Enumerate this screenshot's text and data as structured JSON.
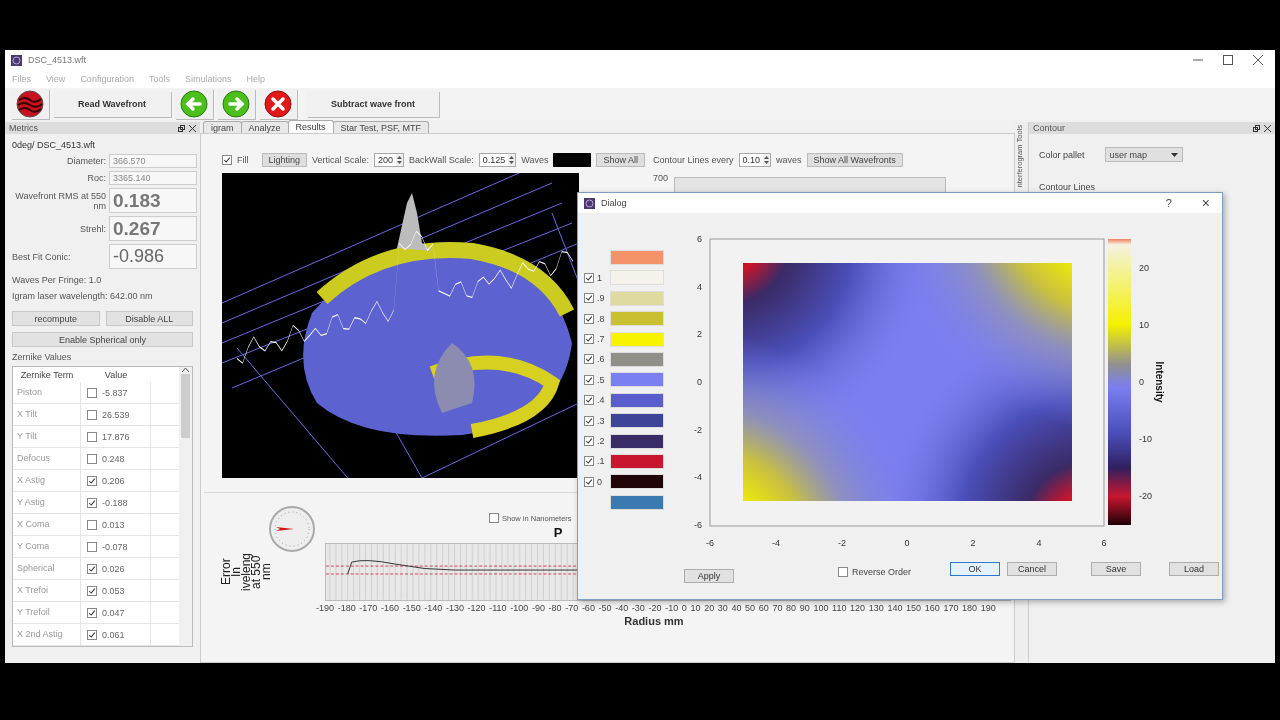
{
  "window": {
    "title": "DSC_4513.wft"
  },
  "menu": [
    "Files",
    "View",
    "Configuration",
    "Tools",
    "Simulations",
    "Help"
  ],
  "toolbar": [
    {
      "kind": "igram"
    },
    {
      "kind": "text",
      "label": "Read Wavefront"
    },
    {
      "kind": "back"
    },
    {
      "kind": "forward"
    },
    {
      "kind": "cancel"
    },
    {
      "kind": "text",
      "label": "Subtract wave front"
    }
  ],
  "metrics": {
    "title": "Metrics",
    "file": "0deg/ DSC_4513.wft",
    "fields": [
      {
        "kind": "small",
        "label": "Diameter:",
        "value": "366.570"
      },
      {
        "kind": "small",
        "label": "Roc:",
        "value": "3365.140"
      },
      {
        "kind": "big",
        "label": "Wavefront RMS at 550 nm",
        "value": "0.183"
      },
      {
        "kind": "big",
        "label": "Strehl:",
        "value": "0.267"
      },
      {
        "kind": "light",
        "label": "Best Fit Conic:",
        "value": "-0.986"
      }
    ],
    "notes": [
      "Waves Per Fringe: 1.0",
      "Igram laser wavelength: 642.00 nm"
    ],
    "buttons": [
      "recompute",
      "Disable ALL",
      "Enable Spherical only"
    ],
    "zernike": {
      "title": "Zernike Values",
      "columns": [
        "Zernike Term",
        "Value"
      ],
      "rows": [
        {
          "term": "Piston",
          "checked": false,
          "value": "-5.837"
        },
        {
          "term": "X Tilt",
          "checked": false,
          "value": "26.539"
        },
        {
          "term": "Y Tilt",
          "checked": false,
          "value": "17.876"
        },
        {
          "term": "Defocus",
          "checked": false,
          "value": "0.248"
        },
        {
          "term": "X Astig",
          "checked": true,
          "value": "0.206"
        },
        {
          "term": "Y Astig",
          "checked": true,
          "value": "-0.188"
        },
        {
          "term": "X Coma",
          "checked": false,
          "value": "0.013"
        },
        {
          "term": "Y Coma",
          "checked": false,
          "value": "-0.078"
        },
        {
          "term": "Spherical",
          "checked": true,
          "value": "0.026"
        },
        {
          "term": "X Trefoi",
          "checked": true,
          "value": "0.053"
        },
        {
          "term": "Y Trefoil",
          "checked": true,
          "value": "0.047"
        },
        {
          "term": "X 2nd Astig",
          "checked": true,
          "value": "0.061"
        }
      ]
    }
  },
  "tabs": [
    {
      "label": "igram",
      "selected": false
    },
    {
      "label": "Analyze",
      "selected": false
    },
    {
      "label": "Results",
      "selected": true
    },
    {
      "label": "Star Test, PSF, MTF",
      "selected": false
    }
  ],
  "surface_controls": {
    "fill": {
      "label": "Fill",
      "checked": true
    },
    "lighting": "Lighting",
    "vertical_scale": {
      "label": "Vertical Scale:",
      "value": "200"
    },
    "backwall_scale": {
      "label": "BackWall Scale:",
      "value": "0.125"
    },
    "waves_label": "Waves",
    "show_all": "Show All"
  },
  "contour_controls": {
    "label": "Contour Lines every",
    "value": "0.10",
    "unit": "waves",
    "button": "Show All Wavefronts",
    "tick": "700"
  },
  "profile": {
    "nanometers": {
      "label": "Show in Nanometers",
      "checked": false
    },
    "title": "P",
    "ylabel_lines": [
      "Error",
      "In",
      "iveleng",
      "at 550",
      "nm"
    ],
    "xticks": [
      "-190",
      "-180",
      "-170",
      "-160",
      "-150",
      "-140",
      "-130",
      "-120",
      "-110",
      "-100",
      "-90",
      "-80",
      "-70",
      "-60",
      "-50",
      "-40",
      "-30",
      "-20",
      "-10",
      "0",
      "10",
      "20",
      "30",
      "40",
      "50",
      "60",
      "70",
      "80",
      "90",
      "100",
      "110",
      "120",
      "130",
      "140",
      "150",
      "160",
      "170",
      "180",
      "190"
    ],
    "xlabel": "Radius mm"
  },
  "contour_dock": {
    "side_tab": "nterferogram Tools",
    "title": "Contour",
    "palette_label": "Color pallet",
    "palette_value": "user map",
    "section": "Contour Lines"
  },
  "dialog": {
    "title": "Dialog",
    "help": "?",
    "close": "×",
    "levels": [
      {
        "kind": "plain",
        "color": "#f4936a"
      },
      {
        "kind": "check",
        "label": "1",
        "checked": true,
        "color": "#f4f2ea"
      },
      {
        "kind": "check",
        "label": ".9",
        "checked": true,
        "color": "#dedaa0"
      },
      {
        "kind": "check",
        "label": ".8",
        "checked": true,
        "color": "#c8c030"
      },
      {
        "kind": "check",
        "label": ".7",
        "checked": true,
        "color": "#f8f400"
      },
      {
        "kind": "check",
        "label": ".6",
        "checked": true,
        "color": "#909088"
      },
      {
        "kind": "check",
        "label": ".5",
        "checked": true,
        "color": "#7a80f2"
      },
      {
        "kind": "check",
        "label": ".4",
        "checked": true,
        "color": "#5a5ecc"
      },
      {
        "kind": "check",
        "label": ".3",
        "checked": true,
        "color": "#3e4498"
      },
      {
        "kind": "check",
        "label": ".2",
        "checked": true,
        "color": "#3a2c66"
      },
      {
        "kind": "check",
        "label": ".1",
        "checked": true,
        "color": "#c8162e"
      },
      {
        "kind": "check",
        "label": "0",
        "checked": true,
        "color": "#200408"
      },
      {
        "kind": "plain",
        "color": "#3a7ab0"
      }
    ],
    "xticks": [
      "-6",
      "-4",
      "-2",
      "0",
      "2",
      "4",
      "6"
    ],
    "yticks": [
      "6",
      "4",
      "2",
      "0",
      "-2",
      "-4",
      "-6"
    ],
    "colorbar_ticks": [
      "20",
      "10",
      "0",
      "-10",
      "-20"
    ],
    "colorbar_label": "Intensity",
    "apply": "Apply",
    "reverse": {
      "label": "Reverse Order",
      "checked": false
    },
    "buttons": [
      {
        "label": "OK",
        "default": true
      },
      {
        "label": "Cancel",
        "default": false
      },
      {
        "label": "Save",
        "default": false
      },
      {
        "label": "Load",
        "default": false
      }
    ]
  }
}
